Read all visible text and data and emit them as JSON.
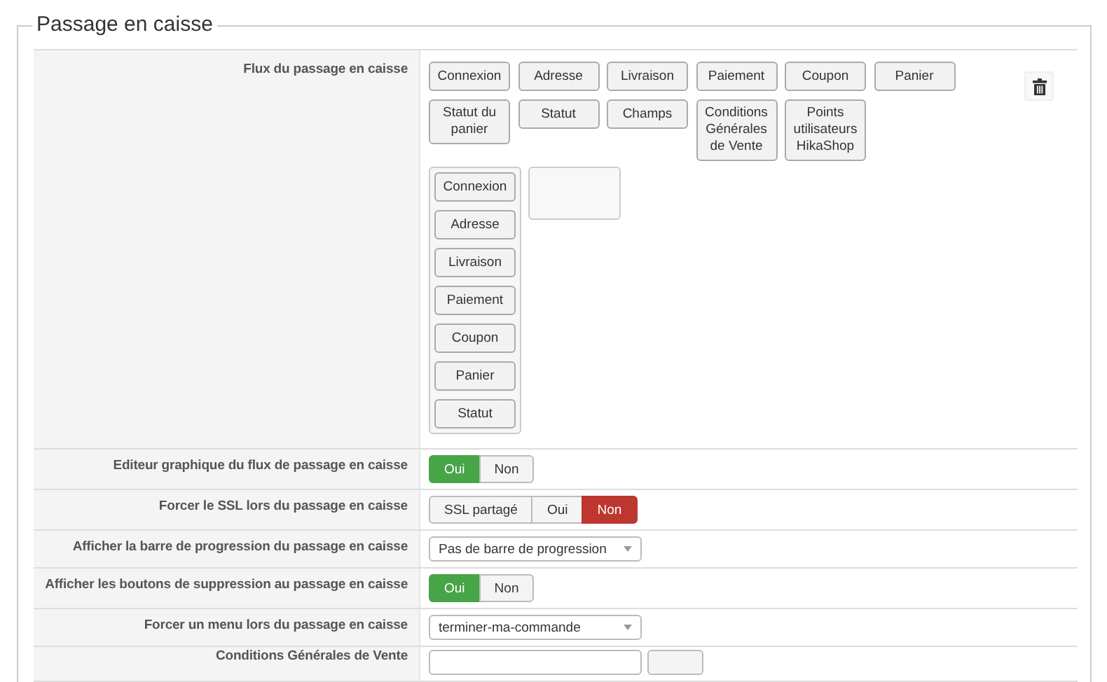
{
  "legend": "Passage en caisse",
  "rows": [
    {
      "kind": "flow",
      "label": "Flux du passage en caisse",
      "palette": [
        "Connexion",
        "Adresse",
        "Livraison",
        "Paiement",
        "Coupon",
        "Panier",
        "Statut du panier",
        "Statut",
        "Champs",
        "Conditions Générales de Vente",
        "Points utilisateurs HikaShop"
      ],
      "steps": [
        "Connexion",
        "Adresse",
        "Livraison",
        "Paiement",
        "Coupon",
        "Panier",
        "Statut"
      ]
    },
    {
      "kind": "toggle",
      "label": "Editeur graphique du flux de passage en caisse",
      "options": [
        {
          "label": "Oui",
          "selected": true,
          "color": "#47a447"
        },
        {
          "label": "Non",
          "selected": false
        }
      ]
    },
    {
      "kind": "toggle",
      "label": "Forcer le SSL lors du passage en caisse",
      "options": [
        {
          "label": "SSL partagé",
          "selected": false
        },
        {
          "label": "Oui",
          "selected": false
        },
        {
          "label": "Non",
          "selected": true,
          "color": "#bd362f"
        }
      ]
    },
    {
      "kind": "select",
      "label": "Afficher la barre de progression du passage en caisse",
      "value": "Pas de barre de progression"
    },
    {
      "kind": "toggle",
      "label": "Afficher les boutons de suppression au passage en caisse",
      "options": [
        {
          "label": "Oui",
          "selected": true,
          "color": "#47a447"
        },
        {
          "label": "Non",
          "selected": false
        }
      ]
    },
    {
      "kind": "select",
      "label": "Forcer un menu lors du passage en caisse",
      "value": "terminer-ma-commande"
    },
    {
      "kind": "select_button",
      "label": "Conditions Générales de Vente"
    }
  ]
}
